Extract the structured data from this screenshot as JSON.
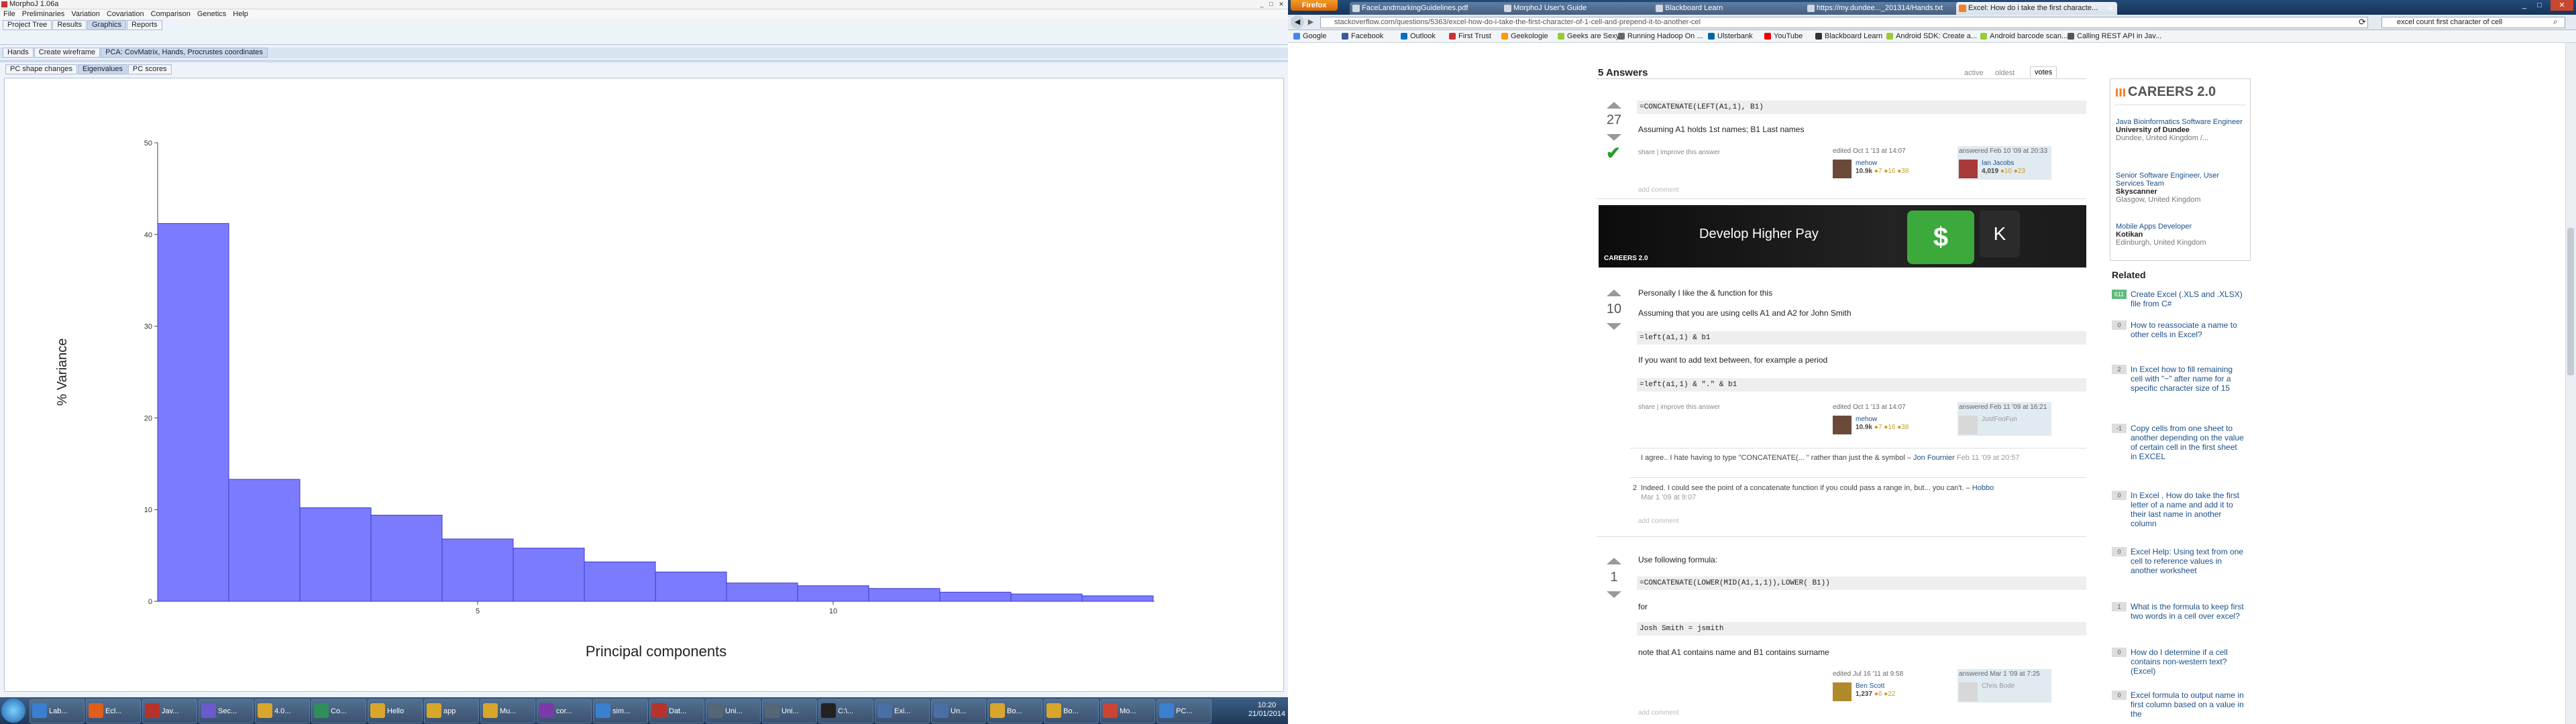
{
  "morphoj": {
    "window_title": "MorphoJ 1.06a",
    "menu": [
      "File",
      "Preliminaries",
      "Variation",
      "Covariation",
      "Comparison",
      "Genetics",
      "Help"
    ],
    "tabs_main": [
      {
        "label": "Project Tree",
        "selected": false
      },
      {
        "label": "Results",
        "selected": false
      },
      {
        "label": "Graphics",
        "selected": true
      },
      {
        "label": "Reports",
        "selected": false
      }
    ],
    "tabs_dataset": [
      {
        "label": "Hands",
        "selected": false
      },
      {
        "label": "Create wireframe",
        "selected": false
      },
      {
        "label": "PCA: CovMatrix, Hands, Procrustes coordinates",
        "selected": true
      }
    ],
    "tabs_graph": [
      {
        "label": "PC shape changes",
        "selected": false
      },
      {
        "label": "Eigenvalues",
        "selected": true
      },
      {
        "label": "PC scores",
        "selected": false
      }
    ]
  },
  "chart_data": {
    "type": "bar",
    "xlabel": "Principal components",
    "ylabel": "% Variance",
    "ylim": [
      0,
      50
    ],
    "yticks": [
      "0",
      "10",
      "20",
      "30",
      "40",
      "50"
    ],
    "xticks": [
      {
        "pc": 5,
        "label": "5"
      },
      {
        "pc": 10,
        "label": "10"
      }
    ],
    "bar_color": "#7b7bff",
    "categories": [
      "1",
      "2",
      "3",
      "4",
      "5",
      "6",
      "7",
      "8",
      "9",
      "10",
      "11",
      "12",
      "13",
      "14"
    ],
    "values": [
      41.2,
      13.3,
      10.2,
      9.4,
      6.8,
      5.8,
      4.3,
      3.2,
      2.0,
      1.7,
      1.4,
      1.0,
      0.8,
      0.6
    ]
  },
  "taskbar": {
    "apps": [
      "Lab...",
      "Ecl...",
      "Jav...",
      "Sec...",
      "4.0...",
      "Co...",
      "Hello",
      "app",
      "Mu...",
      "cor...",
      "sim...",
      "Dat...",
      "Uni...",
      "Uni...",
      "C:\\...",
      "Exi...",
      "Un...",
      "Bo...",
      "Bo...",
      "Mo...",
      "PC..."
    ],
    "time": "10:20",
    "date": "21/01/2014"
  },
  "firefox": {
    "menu_button": "Firefox",
    "tabs": [
      {
        "label": "FaceLandmarkingGuidelines.pdf",
        "selected": false
      },
      {
        "label": "MorphoJ User's Guide",
        "selected": false
      },
      {
        "label": "Blackboard Learn",
        "selected": false
      },
      {
        "label": "https://my.dundee..._201314/Hands.txt",
        "selected": false
      },
      {
        "label": "Excel: How do i take the first characte...",
        "selected": true
      }
    ],
    "url": "stackoverflow.com/questions/5363/excel-how-do-i-take-the-first-character-of-1-cell-and-prepend-it-to-another-cel",
    "search_value": "excel count first character of cell",
    "bookmarks": [
      "Google",
      "Facebook",
      "Outlook",
      "First Trust",
      "Geekologie",
      "Geeks are Sexy",
      "Running Hadoop On ...",
      "Ulsterbank",
      "YouTube",
      "Blackboard Learn",
      "Android SDK: Create a...",
      "Android barcode scan...",
      "Calling REST API in Jav..."
    ]
  },
  "so": {
    "answers_heading": "5 Answers",
    "sort_tabs": [
      "active",
      "oldest",
      "votes"
    ],
    "share_text": "share | improve this answer",
    "add_comment": "add comment",
    "answers": [
      {
        "votes": "27",
        "accepted": true,
        "code": "=CONCATENATE(LEFT(A1,1), B1)",
        "text": "Assuming A1 holds 1st names; B1 Last names",
        "edited": "edited Oct 1 '13 at 14:07",
        "editor": "mehow",
        "editor_rep": "10.9k",
        "editor_badges": "●7 ●16 ●38",
        "answered": "answered Feb 10 '09 at 20:33",
        "author": "Ian Jacobs",
        "author_rep": "4,019",
        "author_badges": "●10 ●23"
      },
      {
        "votes": "10",
        "text1": "Personally I like the & function for this",
        "text2": "Assuming that you are using cells A1 and A2 for John Smith",
        "code1": "=left(a1,1) & b1",
        "text3": "If you want to add text between, for example a period",
        "code2": "=left(a1,1) & \".\" & b1",
        "edited": "edited Oct 1 '13 at 14:07",
        "editor": "mehow",
        "editor_rep": "10.9k",
        "editor_badges": "●7 ●16 ●38",
        "answered": "answered Feb 11 '09 at 16:21",
        "author": "JustFooFun",
        "comments": [
          {
            "score": "",
            "text": "I agree.. I hate having to type \"CONCATENATE(... \" rather than just the & symbol –",
            "user": "Jon Fournier",
            "date": "Feb 11 '09 at 20:57"
          },
          {
            "score": "2",
            "text": "Indeed. I could see the point of a concatenate function if you could pass a range in, but... you can't. –",
            "user": "Hobbo",
            "date": "Mar 1 '09 at 9:07"
          }
        ]
      },
      {
        "votes": "1",
        "text1": "Use following formula:",
        "code1": "=CONCATENATE(LOWER(MID(A1,1,1)),LOWER( B1))",
        "text2": "for",
        "code2": "Josh Smith = jsmith",
        "text3": "note that A1 contains name and B1 contains surname",
        "edited": "edited Jul 16 '11 at 9:58",
        "editor": "Ben Scott",
        "editor_rep": "1,237",
        "editor_badges": "●6 ●22",
        "answered": "answered Mar 1 '09 at 7:25",
        "author": "Chris Bode"
      }
    ],
    "ad": {
      "text": "Develop Higher Pay",
      "key1": "$",
      "key2": "K",
      "brand": "CAREERS 2.0"
    },
    "careers": {
      "title": "CAREERS 2.0",
      "jobs": [
        {
          "title": "Java Bioinformatics Software Engineer",
          "company": "University of Dundee",
          "location": "Dundee, United Kingdom /..."
        },
        {
          "title": "Senior Software Engineer, User Services Team",
          "company": "Skyscanner",
          "location": "Glasgow, United Kingdom"
        },
        {
          "title": "Mobile Apps Developer",
          "company": "Kotikan",
          "location": "Edinburgh, United Kingdom"
        }
      ]
    },
    "related_heading": "Related",
    "related": [
      {
        "count": "611",
        "q": "Create Excel (.XLS and .XLSX) file from C#"
      },
      {
        "count": "0",
        "q": "How to reassociate a name to other cells in Excel?"
      },
      {
        "count": "2",
        "q": "In Excel how to fill remaining cell with \"~\" after name for a specific character size of 15"
      },
      {
        "count": "-1",
        "q": "Copy cells from one sheet to another depending on the value of certain cell in the first sheet in EXCEL"
      },
      {
        "count": "0",
        "q": "In Excel , How do take the first letter of a name and add it to their last name in another column"
      },
      {
        "count": "0",
        "q": "Excel Help: Using text from one cell to reference values in another worksheet"
      },
      {
        "count": "1",
        "q": "What is the formula to keep first two words in a cell over excel?"
      },
      {
        "count": "0",
        "q": "How do I determine if a cell contains non-western text? (Excel)"
      },
      {
        "count": "0",
        "q": "Excel formula to output name in first column based on a value in the"
      }
    ]
  }
}
